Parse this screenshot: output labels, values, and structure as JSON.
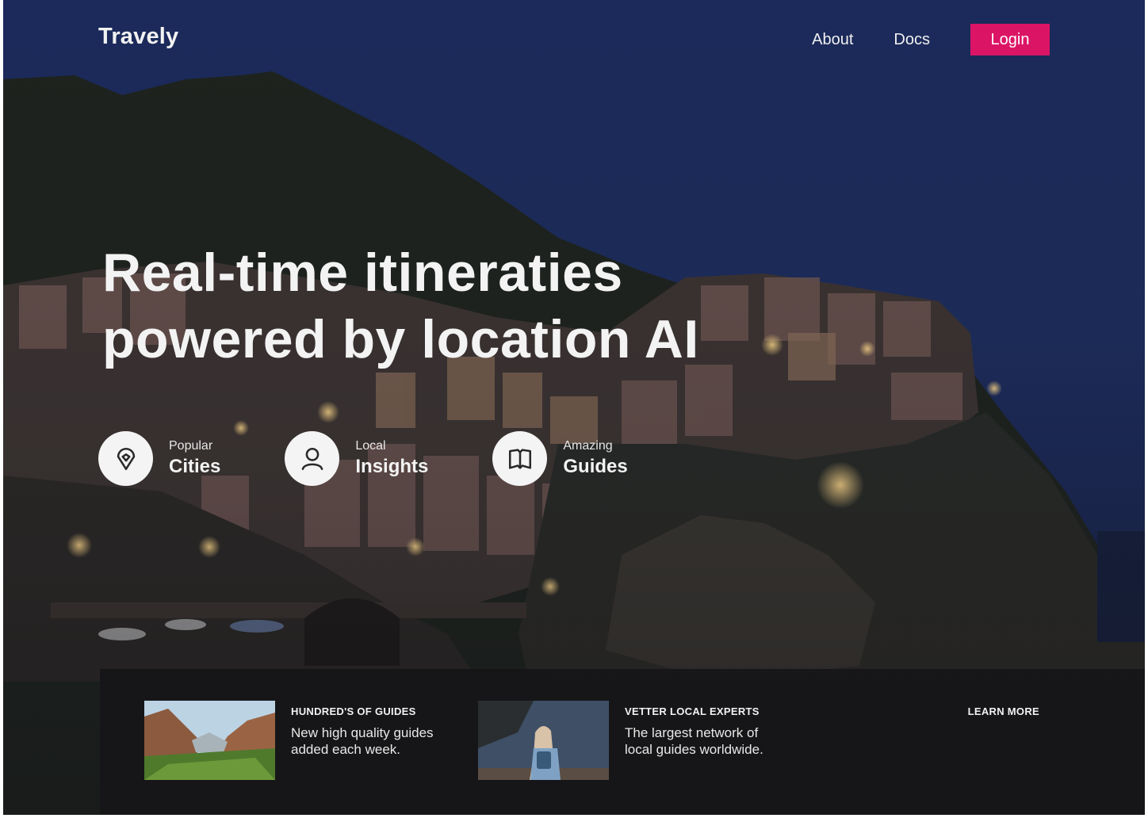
{
  "brand": {
    "logo": "Travely"
  },
  "nav": {
    "about": "About",
    "docs": "Docs",
    "login": "Login"
  },
  "hero": {
    "headline_line1": "Real-time itineraties",
    "headline_line2": "powered by location AI"
  },
  "features": [
    {
      "small": "Popular",
      "big": "Cities",
      "icon": "map-pin-icon"
    },
    {
      "small": "Local",
      "big": "Insights",
      "icon": "user-icon"
    },
    {
      "small": "Amazing",
      "big": "Guides",
      "icon": "book-icon"
    }
  ],
  "cards": [
    {
      "title": "HUNDRED'S OF GUIDES",
      "desc": "New high quality guides added each week.",
      "image": "canyon-valley-photo"
    },
    {
      "title": "VETTER LOCAL EXPERTS",
      "desc": "The largest network of local guides worldwide.",
      "image": "traveler-seaside-photo"
    }
  ],
  "learn_more": "LEARN MORE",
  "colors": {
    "accent": "#dc1466",
    "sky": "#1b2a5a",
    "panel": "#161618"
  }
}
